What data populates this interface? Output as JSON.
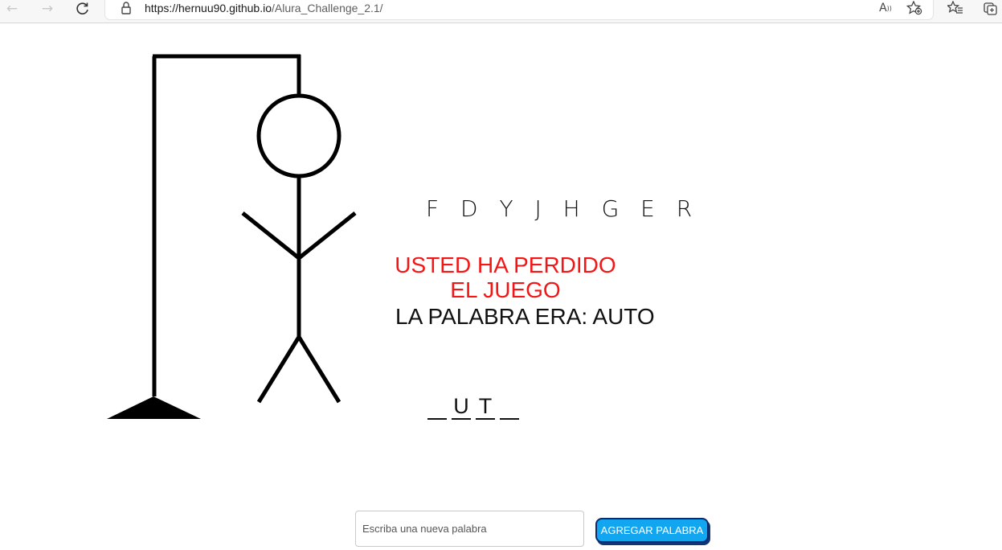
{
  "browser": {
    "url_host": "https://hernuu90.github.io",
    "url_path": "/Alura_Challenge_2.1/",
    "icons": [
      "back-icon",
      "forward-icon",
      "refresh-icon",
      "lock-icon",
      "read-aloud-icon",
      "add-favorite-icon",
      "favorites-icon",
      "collections-icon"
    ]
  },
  "game": {
    "wrong_letters": "F D Y J H G E R",
    "lose_line1": "USTED HA PERDIDO",
    "lose_line2": "EL JUEGO",
    "answer": "LA PALABRA ERA: AUTO",
    "word_slots": [
      "",
      "U",
      "T",
      ""
    ],
    "lose_color": "#f31616"
  },
  "form": {
    "input_placeholder": "Escriba una nueva palabra",
    "button_label": "AGREGAR PALABRA",
    "button_color": "#12a6f0"
  }
}
